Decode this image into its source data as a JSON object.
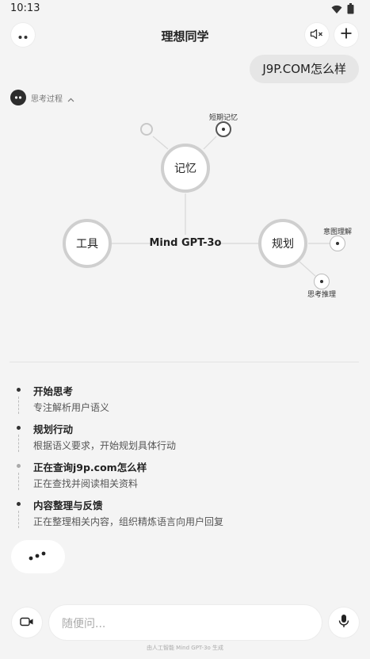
{
  "status_bar": {
    "time": "10:13",
    "icons": [
      "wifi-icon",
      "battery-icon"
    ]
  },
  "header": {
    "title": "理想同学",
    "icons": [
      "more-icon",
      "mute-icon",
      "plus-icon"
    ]
  },
  "user_message": "J9P.COM怎么样",
  "thinking": {
    "label": "思考过程"
  },
  "diagram": {
    "center": "Mind GPT-3o",
    "nodes": {
      "memory": "记忆",
      "tools": "工具",
      "planning": "规划"
    },
    "sub": {
      "short_memory": "短期记忆",
      "intent": "意图理解",
      "reasoning": "思考推理"
    }
  },
  "steps": [
    {
      "title": "开始思考",
      "desc": "专注解析用户语义"
    },
    {
      "title": "规划行动",
      "desc": "根据语义要求，开始规划具体行动"
    },
    {
      "title": "正在查询j9p.com怎么样",
      "desc": "正在查找并阅读相关资料"
    },
    {
      "title": "内容整理与反馈",
      "desc": "正在整理相关内容，组织精炼语言向用户回复"
    }
  ],
  "input": {
    "placeholder": "随便问..."
  },
  "footer": "由人工智能 Mind GPT-3o 生成",
  "colors": {
    "background": "#f4f4f4",
    "node_border": "#cfcfcf",
    "text": "#222222"
  }
}
